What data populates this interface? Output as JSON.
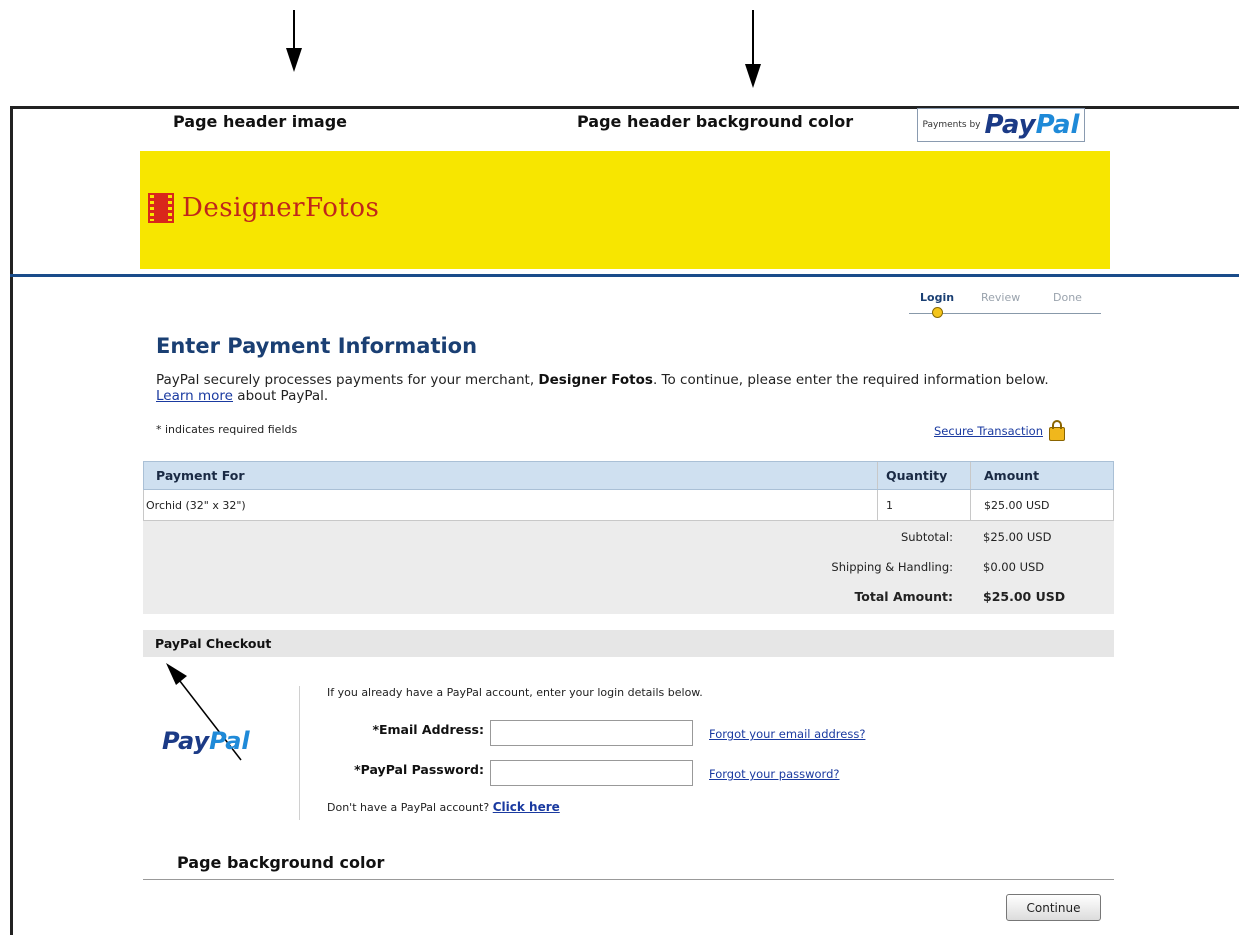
{
  "annotations": {
    "header_image": "Page header image",
    "header_bg": "Page header background color",
    "page_bg": "Page background color"
  },
  "paypal_badge": {
    "small": "Payments by",
    "logo_a": "Pay",
    "logo_b": "Pal"
  },
  "merchant_logo": "DesignerFotos",
  "steps": [
    "Login",
    "Review",
    "Done"
  ],
  "title": "Enter Payment Information",
  "intro": {
    "part1": "PayPal securely processes payments for your merchant, ",
    "merchant": "Designer Fotos",
    "part2": ". To continue, please enter the required information below. ",
    "learn_more": "Learn more",
    "part3": " about PayPal."
  },
  "required_note": "* indicates required fields",
  "secure_transaction": "Secure Transaction",
  "table": {
    "headers": [
      "Payment For",
      "Quantity",
      "Amount"
    ],
    "rows": [
      {
        "item": "Orchid (32\" x 32\")",
        "qty": "1",
        "amount": "$25.00 USD"
      }
    ],
    "subtotal_label": "Subtotal:",
    "subtotal_value": "$25.00 USD",
    "shipping_label": "Shipping & Handling:",
    "shipping_value": "$0.00 USD",
    "total_label": "Total Amount:",
    "total_value": "$25.00 USD"
  },
  "checkout": {
    "section_title": "PayPal Checkout",
    "logo_a": "Pay",
    "logo_b": "Pal",
    "intro": "If you already have a PayPal account, enter your login details below.",
    "email_label": "*Email Address:",
    "email_value": "",
    "password_label": "*PayPal Password:",
    "password_value": "",
    "forgot_email": "Forgot your email address?",
    "forgot_password": "Forgot your password?",
    "no_account": "Don't have a PayPal account? ",
    "click_here": "Click here"
  },
  "continue_button": "Continue",
  "colors": {
    "header_bg": "#f7e600",
    "rule": "#1a4c8a",
    "title": "#1a3f73",
    "table_head": "#cfe0f0"
  }
}
